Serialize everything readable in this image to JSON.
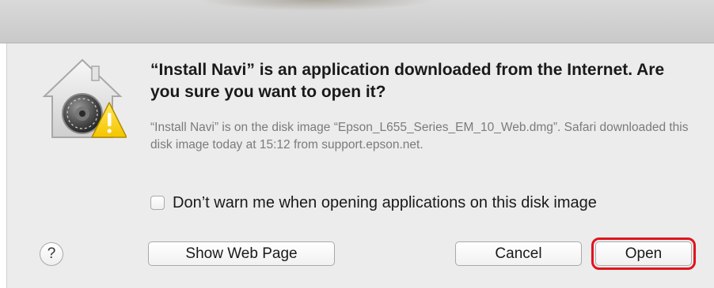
{
  "dialog": {
    "heading": "“Install Navi” is an application downloaded from the Internet. Are you sure you want to open it?",
    "info": "“Install Navi” is on the disk image “Epson_L655_Series_EM_10_Web.dmg”. Safari downloaded this disk image today at 15:12 from support.epson.net.",
    "checkbox": {
      "label": "Don’t warn me when opening applications on this disk image",
      "checked": false
    },
    "icon": "gatekeeper-warning-icon",
    "help_label": "?",
    "buttons": {
      "show_web_page": "Show Web Page",
      "cancel": "Cancel",
      "open": "Open"
    },
    "highlight_color": "#e0141e"
  }
}
